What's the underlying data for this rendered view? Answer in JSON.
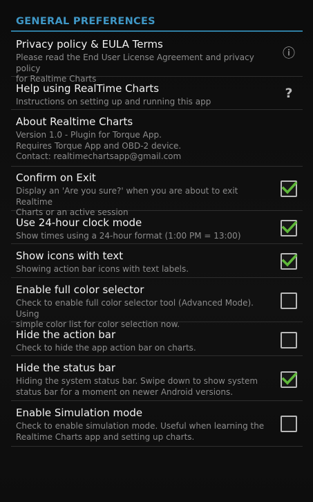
{
  "section": {
    "title": "GENERAL PREFERENCES"
  },
  "prefs": [
    {
      "title": "Privacy policy & EULA Terms",
      "summary": "Please read the End User License Agreement and privacy policy\nfor Realtime Charts",
      "widget": "info-icon"
    },
    {
      "title": "Help using RealTime Charts",
      "summary": "Instructions on setting up and running this app",
      "widget": "help-icon"
    },
    {
      "title": "About Realtime Charts",
      "summary": "Version 1.0 - Plugin for Torque App.\nRequires Torque App and OBD-2 device.\nContact: realtimechartsapp@gmail.com"
    },
    {
      "title": "Confirm on Exit",
      "summary": "Display an 'Are you sure?' when you are about to exit Realtime\nCharts or an active session",
      "checked": true
    },
    {
      "title": "Use 24-hour clock mode",
      "summary": "Show times using a 24-hour format (1:00 PM = 13:00)",
      "checked": true
    },
    {
      "title": "Show icons with text",
      "summary": "Showing action bar icons with text labels.",
      "checked": true
    },
    {
      "title": "Enable full color selector",
      "summary": "Check to enable full color selector tool (Advanced Mode). Using\nsimple color list for color selection now.",
      "checked": false
    },
    {
      "title": "Hide the action bar",
      "summary": "Check to hide the app action bar on charts.",
      "checked": false
    },
    {
      "title": "Hide the status bar",
      "summary": "Hiding the system status bar. Swipe down to show system\nstatus bar for a moment on newer Android versions.",
      "checked": true
    },
    {
      "title": "Enable Simulation mode",
      "summary": "Check to enable simulation mode. Useful when learning the\nRealtime Charts app and setting up charts.",
      "checked": false
    }
  ],
  "icons": {
    "info": "ⓘ",
    "help": "?"
  },
  "colors": {
    "accent": "#3f97c6",
    "check": "#5fb83a"
  }
}
